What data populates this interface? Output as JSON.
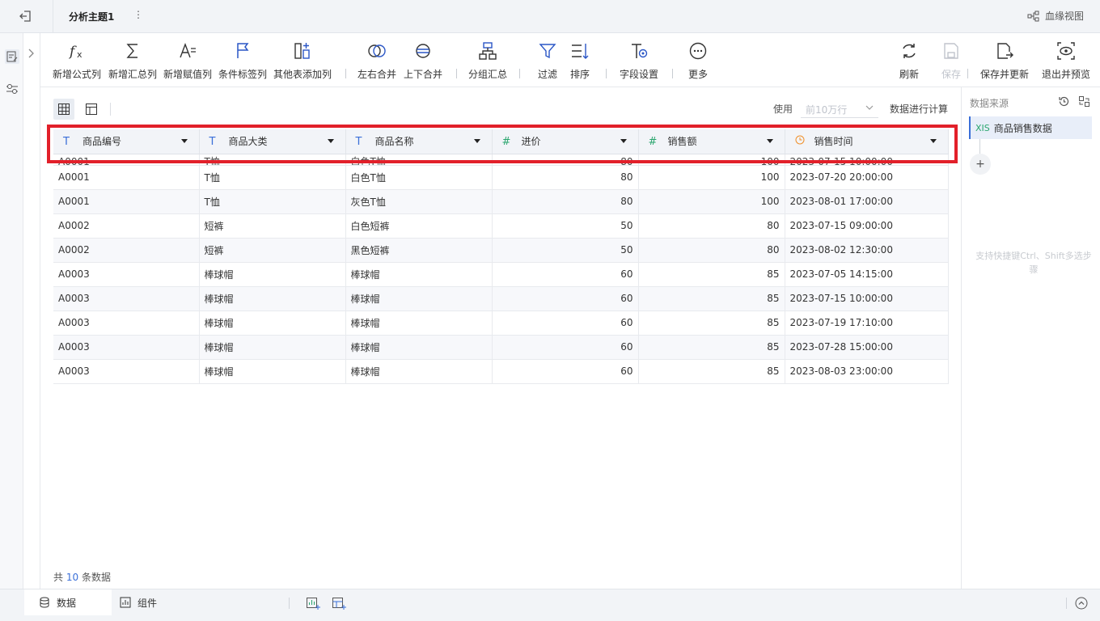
{
  "topbar": {
    "tab_title": "分析主题1",
    "more": "⋮",
    "lineage_label": "血缘视图"
  },
  "toolbar": {
    "add_formula": "新增公式列",
    "add_summary": "新增汇总列",
    "add_assign": "新增赋值列",
    "cond_label": "条件标签列",
    "other_table": "其他表添加列",
    "merge_lr": "左右合并",
    "merge_ud": "上下合并",
    "group_summary": "分组汇总",
    "filter": "过滤",
    "sort": "排序",
    "field_settings": "字段设置",
    "more": "更多",
    "refresh": "刷新",
    "save": "保存",
    "save_update": "保存并更新",
    "exit_preview": "退出并预览"
  },
  "main": {
    "use_label": "使用",
    "rows_placeholder": "前10万行",
    "calc_label": "数据进行计算",
    "total_prefix": "共",
    "total_count": "10",
    "total_suffix": "条数据"
  },
  "grid": {
    "columns": [
      {
        "label": "商品编号",
        "type": "T"
      },
      {
        "label": "商品大类",
        "type": "T"
      },
      {
        "label": "商品名称",
        "type": "T"
      },
      {
        "label": "进价",
        "type": "#"
      },
      {
        "label": "销售额",
        "type": "#"
      },
      {
        "label": "销售时间",
        "type": "time"
      }
    ],
    "rows": [
      [
        "A0001",
        "T恤",
        "白色T恤",
        "80",
        "100",
        "2023-07-15 10:00:00"
      ],
      [
        "A0001",
        "T恤",
        "白色T恤",
        "80",
        "100",
        "2023-07-20 20:00:00"
      ],
      [
        "A0001",
        "T恤",
        "灰色T恤",
        "80",
        "100",
        "2023-08-01 17:00:00"
      ],
      [
        "A0002",
        "短裤",
        "白色短裤",
        "50",
        "80",
        "2023-07-15 09:00:00"
      ],
      [
        "A0002",
        "短裤",
        "黑色短裤",
        "50",
        "80",
        "2023-08-02 12:30:00"
      ],
      [
        "A0003",
        "棒球帽",
        "棒球帽",
        "60",
        "85",
        "2023-07-05 14:15:00"
      ],
      [
        "A0003",
        "棒球帽",
        "棒球帽",
        "60",
        "85",
        "2023-07-15 10:00:00"
      ],
      [
        "A0003",
        "棒球帽",
        "棒球帽",
        "60",
        "85",
        "2023-07-19 17:10:00"
      ],
      [
        "A0003",
        "棒球帽",
        "棒球帽",
        "60",
        "85",
        "2023-07-28 15:00:00"
      ],
      [
        "A0003",
        "棒球帽",
        "棒球帽",
        "60",
        "85",
        "2023-08-03 23:00:00"
      ]
    ]
  },
  "right_pane": {
    "title": "数据来源",
    "source_icon": "XIS",
    "source_name": "商品销售数据",
    "add": "+",
    "hint": "支持快捷键Ctrl、Shift多选步骤"
  },
  "bottom": {
    "data_tab": "数据",
    "component_tab": "组件"
  },
  "colors": {
    "accent": "#3a6fd8",
    "number_type": "#2aa66e",
    "time_type": "#f0902a",
    "highlight": "#e2202a"
  }
}
